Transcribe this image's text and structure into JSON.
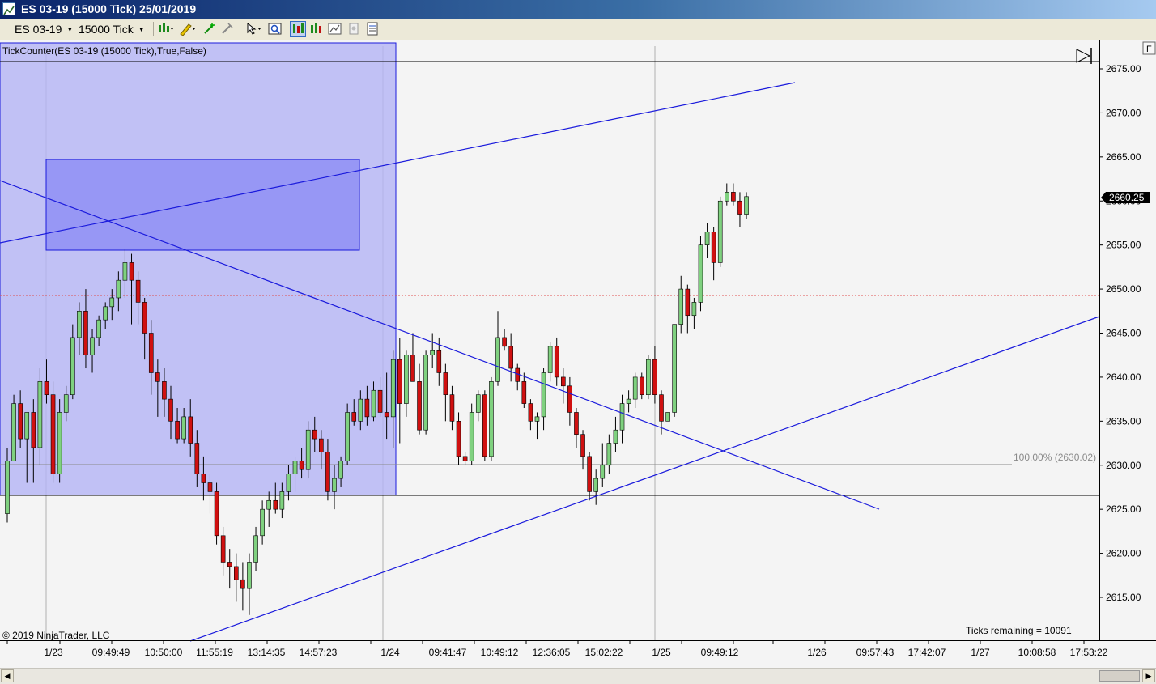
{
  "window": {
    "title": "ES 03-19 (15000 Tick)  25/01/2019"
  },
  "toolbar": {
    "instrument": "ES 03-19",
    "interval": "15000 Tick",
    "buttons": [
      "bar-type-icon",
      "pencil-draw-icon",
      "plus-crosshair-icon",
      "eraser-icon",
      "pointer-icon",
      "zoom-icon",
      "data-box-icon",
      "chart-style-icon",
      "chart-panels-icon",
      "properties-icon",
      "notes-icon"
    ]
  },
  "chart": {
    "indicator_label": "TickCounter(ES  03-19 (15000  Tick),True,False)",
    "copyright": "© 2019 NinjaTrader, LLC",
    "ticks_remaining": "Ticks remaining = 10091",
    "fib_label": "100.00% (2630.02)",
    "last_price": "2660.25",
    "f_button": "F",
    "colors": {
      "up": "#7fd17f",
      "down": "#d01010",
      "drawing": "#1a1adc",
      "zone": "#b4b4f5",
      "box": "#8c8cf5"
    }
  },
  "chart_data": {
    "type": "candlestick",
    "y_axis": {
      "min": 2610.5,
      "max": 2677.5,
      "ticks": [
        2615.0,
        2620.0,
        2625.0,
        2630.0,
        2635.0,
        2640.0,
        2645.0,
        2650.0,
        2655.0,
        2660.0,
        2665.0,
        2670.0,
        2675.0
      ]
    },
    "x_labels": [
      "1/23",
      "09:49:49",
      "10:50:00",
      "11:55:19",
      "13:14:35",
      "14:57:23",
      "1/24",
      "09:41:47",
      "10:49:12",
      "12:36:05",
      "15:02:22",
      "1/25",
      "09:49:12",
      "1/26",
      "09:57:43",
      "17:42:07",
      "1/27",
      "10:08:58",
      "17:53:22"
    ],
    "candles": [
      [
        2624.5,
        2632.0,
        2623.5,
        2630.5
      ],
      [
        2630.5,
        2638.0,
        2630.5,
        2637.0
      ],
      [
        2637.0,
        2638.5,
        2632.0,
        2633.0
      ],
      [
        2633.0,
        2635.0,
        2628.0,
        2636.0
      ],
      [
        2636.0,
        2637.5,
        2628.0,
        2632.0
      ],
      [
        2632.0,
        2641.0,
        2630.0,
        2639.5
      ],
      [
        2639.5,
        2642.0,
        2637.0,
        2638.0
      ],
      [
        2638.0,
        2639.5,
        2628.0,
        2629.0
      ],
      [
        2629.0,
        2637.5,
        2628.0,
        2636.0
      ],
      [
        2636.0,
        2639.0,
        2635.0,
        2638.0
      ],
      [
        2638.0,
        2646.0,
        2637.5,
        2644.5
      ],
      [
        2644.5,
        2648.5,
        2642.5,
        2647.5
      ],
      [
        2647.5,
        2650.0,
        2641.0,
        2642.5
      ],
      [
        2642.5,
        2645.5,
        2640.5,
        2644.5
      ],
      [
        2644.5,
        2647.0,
        2643.5,
        2646.5
      ],
      [
        2646.5,
        2648.5,
        2645.5,
        2648.0
      ],
      [
        2648.0,
        2650.0,
        2646.5,
        2649.0
      ],
      [
        2649.0,
        2652.0,
        2647.5,
        2651.0
      ],
      [
        2651.0,
        2654.5,
        2649.0,
        2653.0
      ],
      [
        2653.0,
        2654.0,
        2646.0,
        2651.0
      ],
      [
        2651.0,
        2652.0,
        2646.0,
        2648.5
      ],
      [
        2648.5,
        2649.0,
        2642.0,
        2645.0
      ],
      [
        2645.0,
        2646.5,
        2638.0,
        2640.5
      ],
      [
        2640.5,
        2642.0,
        2635.5,
        2639.5
      ],
      [
        2639.5,
        2641.0,
        2635.5,
        2637.5
      ],
      [
        2637.5,
        2639.0,
        2633.0,
        2635.0
      ],
      [
        2635.0,
        2636.5,
        2632.5,
        2633.0
      ],
      [
        2633.0,
        2636.5,
        2632.5,
        2635.5
      ],
      [
        2635.5,
        2637.5,
        2631.0,
        2632.5
      ],
      [
        2632.5,
        2634.0,
        2627.5,
        2629.0
      ],
      [
        2629.0,
        2631.0,
        2626.0,
        2628.0
      ],
      [
        2628.0,
        2629.0,
        2624.5,
        2627.0
      ],
      [
        2627.0,
        2628.0,
        2621.0,
        2622.0
      ],
      [
        2622.0,
        2623.0,
        2617.5,
        2619.0
      ],
      [
        2619.0,
        2620.5,
        2616.0,
        2618.5
      ],
      [
        2618.5,
        2620.0,
        2614.5,
        2617.0
      ],
      [
        2617.0,
        2619.0,
        2613.5,
        2616.0
      ],
      [
        2616.0,
        2620.0,
        2613.0,
        2619.0
      ],
      [
        2619.0,
        2623.0,
        2618.0,
        2622.0
      ],
      [
        2622.0,
        2626.0,
        2621.0,
        2625.0
      ],
      [
        2625.0,
        2627.0,
        2623.0,
        2626.0
      ],
      [
        2626.0,
        2628.0,
        2624.5,
        2625.0
      ],
      [
        2625.0,
        2628.0,
        2624.0,
        2627.0
      ],
      [
        2627.0,
        2630.0,
        2626.0,
        2629.0
      ],
      [
        2629.0,
        2631.0,
        2627.0,
        2630.5
      ],
      [
        2630.5,
        2632.0,
        2628.5,
        2629.5
      ],
      [
        2629.5,
        2635.0,
        2628.5,
        2634.0
      ],
      [
        2634.0,
        2635.5,
        2631.5,
        2633.0
      ],
      [
        2633.0,
        2634.0,
        2629.5,
        2631.5
      ],
      [
        2631.5,
        2633.0,
        2626.0,
        2627.0
      ],
      [
        2627.0,
        2630.0,
        2625.0,
        2628.5
      ],
      [
        2628.5,
        2631.0,
        2627.5,
        2630.5
      ],
      [
        2630.5,
        2637.0,
        2630.0,
        2636.0
      ],
      [
        2636.0,
        2637.5,
        2634.5,
        2635.0
      ],
      [
        2635.0,
        2638.5,
        2634.0,
        2637.5
      ],
      [
        2637.5,
        2639.0,
        2634.5,
        2635.5
      ],
      [
        2635.5,
        2639.5,
        2635.0,
        2638.5
      ],
      [
        2638.5,
        2640.0,
        2635.5,
        2636.0
      ],
      [
        2636.0,
        2640.5,
        2633.0,
        2635.5
      ],
      [
        2635.5,
        2643.0,
        2632.0,
        2642.0
      ],
      [
        2642.0,
        2644.5,
        2632.5,
        2637.0
      ],
      [
        2637.0,
        2643.0,
        2635.5,
        2642.5
      ],
      [
        2642.5,
        2645.0,
        2641.0,
        2639.5
      ],
      [
        2639.5,
        2641.5,
        2633.5,
        2634.0
      ],
      [
        2634.0,
        2643.0,
        2633.5,
        2642.5
      ],
      [
        2642.5,
        2645.0,
        2641.0,
        2643.0
      ],
      [
        2643.0,
        2644.5,
        2639.0,
        2640.5
      ],
      [
        2640.5,
        2641.5,
        2635.0,
        2638.0
      ],
      [
        2638.0,
        2639.0,
        2634.0,
        2635.0
      ],
      [
        2635.0,
        2636.0,
        2630.0,
        2631.0
      ],
      [
        2631.0,
        2631.5,
        2630.0,
        2630.5
      ],
      [
        2630.5,
        2637.0,
        2630.0,
        2636.0
      ],
      [
        2636.0,
        2638.5,
        2635.0,
        2638.0
      ],
      [
        2638.0,
        2638.5,
        2630.5,
        2631.0
      ],
      [
        2631.0,
        2640.0,
        2630.5,
        2639.5
      ],
      [
        2639.5,
        2647.5,
        2639.0,
        2644.5
      ],
      [
        2644.5,
        2645.5,
        2643.0,
        2643.5
      ],
      [
        2643.5,
        2645.0,
        2639.5,
        2641.0
      ],
      [
        2641.0,
        2641.5,
        2638.5,
        2639.5
      ],
      [
        2639.5,
        2640.5,
        2636.5,
        2637.0
      ],
      [
        2637.0,
        2637.5,
        2634.0,
        2635.0
      ],
      [
        2635.0,
        2636.0,
        2633.0,
        2635.5
      ],
      [
        2635.5,
        2641.0,
        2634.0,
        2640.5
      ],
      [
        2640.5,
        2644.0,
        2639.5,
        2643.5
      ],
      [
        2643.5,
        2644.5,
        2639.0,
        2640.0
      ],
      [
        2640.0,
        2641.0,
        2637.0,
        2639.0
      ],
      [
        2639.0,
        2640.0,
        2634.5,
        2636.0
      ],
      [
        2636.0,
        2636.5,
        2632.0,
        2633.5
      ],
      [
        2633.5,
        2634.0,
        2629.5,
        2631.0
      ],
      [
        2631.0,
        2631.5,
        2626.0,
        2627.0
      ],
      [
        2627.0,
        2629.5,
        2625.5,
        2628.5
      ],
      [
        2628.5,
        2632.5,
        2627.5,
        2630.0
      ],
      [
        2630.0,
        2633.5,
        2629.0,
        2632.5
      ],
      [
        2632.5,
        2635.5,
        2631.5,
        2634.0
      ],
      [
        2634.0,
        2638.0,
        2632.5,
        2637.0
      ],
      [
        2637.0,
        2638.5,
        2636.0,
        2637.5
      ],
      [
        2637.5,
        2640.5,
        2636.5,
        2640.0
      ],
      [
        2640.0,
        2640.5,
        2637.5,
        2638.0
      ],
      [
        2638.0,
        2642.5,
        2637.5,
        2642.0
      ],
      [
        2642.0,
        2643.5,
        2637.0,
        2638.0
      ],
      [
        2638.0,
        2638.5,
        2633.5,
        2635.0
      ],
      [
        2635.0,
        2636.0,
        2635.0,
        2636.0
      ],
      [
        2636.0,
        2646.0,
        2635.5,
        2646.0
      ],
      [
        2646.0,
        2651.5,
        2645.0,
        2650.0
      ],
      [
        2650.0,
        2650.5,
        2645.0,
        2647.0
      ],
      [
        2647.0,
        2649.0,
        2645.5,
        2648.5
      ],
      [
        2648.5,
        2656.0,
        2647.5,
        2655.0
      ],
      [
        2655.0,
        2657.5,
        2653.5,
        2656.5
      ],
      [
        2656.5,
        2657.0,
        2651.0,
        2653.0
      ],
      [
        2653.0,
        2660.5,
        2652.5,
        2660.0
      ],
      [
        2660.0,
        2662.0,
        2659.5,
        2661.0
      ],
      [
        2661.0,
        2662.0,
        2659.5,
        2660.0
      ],
      [
        2660.0,
        2661.0,
        2657.0,
        2658.5
      ],
      [
        2658.5,
        2661.0,
        2658.0,
        2660.5
      ]
    ]
  }
}
